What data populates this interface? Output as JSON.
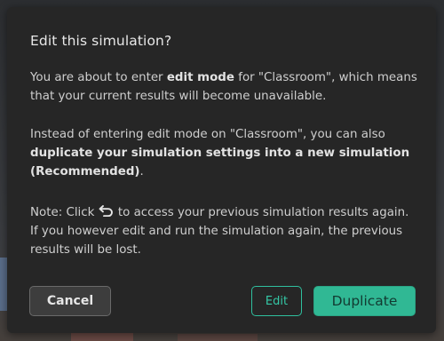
{
  "dialog": {
    "title": "Edit this simulation?",
    "p1_a": "You are about to enter ",
    "p1_bold": "edit mode",
    "p1_b": " for \"Classroom\", which means that your current results will become unavailable.",
    "p2_a": "Instead of entering edit mode on \"Classroom\", you can also ",
    "p2_bold": "duplicate your simulation settings into a new simulation (Recommended)",
    "p2_b": ".",
    "p3_a": "Note: Click ",
    "p3_icon": "undo-icon",
    "p3_b": " to access your previous simulation results again. If you however edit and run the simulation again, the previous results will be lost."
  },
  "buttons": {
    "cancel": "Cancel",
    "edit": "Edit",
    "duplicate": "Duplicate"
  },
  "colors": {
    "accent": "#30b894",
    "dialog_bg": "#262626"
  }
}
